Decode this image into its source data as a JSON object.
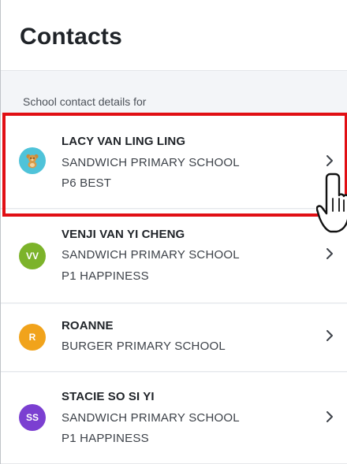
{
  "header": {
    "title": "Contacts"
  },
  "section": {
    "label": "School contact details for"
  },
  "contacts": [
    {
      "name": "LACY VAN LING LING",
      "school": "SANDWICH PRIMARY SCHOOL",
      "class": "P6 BEST",
      "avatar_initials": "",
      "avatar_icon": "teddy-bear-icon",
      "avatar_color": "#4fc3d9"
    },
    {
      "name": "VENJI VAN YI CHENG",
      "school": "SANDWICH PRIMARY SCHOOL",
      "class": "P1 HAPPINESS",
      "avatar_initials": "VV",
      "avatar_color": "#7cb32a"
    },
    {
      "name": "ROANNE",
      "school": "BURGER PRIMARY SCHOOL",
      "class": "",
      "avatar_initials": "R",
      "avatar_color": "#f1a31b"
    },
    {
      "name": "STACIE SO SI YI",
      "school": "SANDWICH PRIMARY SCHOOL",
      "class": "P1 HAPPINESS",
      "avatar_initials": "SS",
      "avatar_color": "#7b3fd1"
    }
  ],
  "colors": {
    "highlight": "#e10f14",
    "text": "#1f2328"
  },
  "icons": {
    "row_chevron": "chevron-right-icon",
    "pointer": "pointing-hand-icon"
  }
}
